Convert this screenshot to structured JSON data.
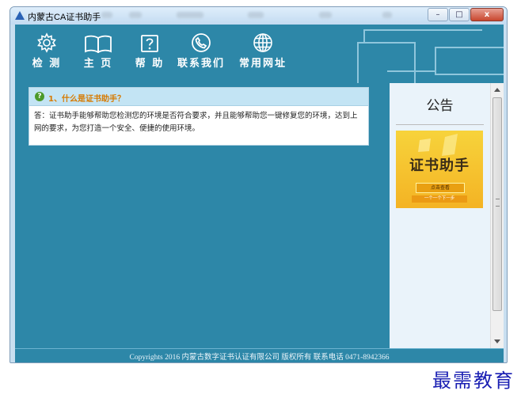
{
  "window": {
    "title": "内蒙古CA证书助手",
    "controls": {
      "minimize": "–",
      "maximize": "□",
      "close": "x"
    }
  },
  "toolbar": {
    "items": [
      {
        "label": "检 测",
        "icon": "gear-icon"
      },
      {
        "label": "主 页",
        "icon": "book-icon"
      },
      {
        "label": "帮 助",
        "icon": "help-icon"
      },
      {
        "label": "联系我们",
        "icon": "phone-icon"
      },
      {
        "label": "常用网址",
        "icon": "globe-icon"
      }
    ]
  },
  "faq": {
    "question": "1、什么是证书助手？",
    "answer": "答：证书助手能够帮助您检测您的环境是否符合要求，并且能够帮助您一键修复您的环境，达到上网的要求，为您打造一个安全、便捷的使用环境。"
  },
  "notice": {
    "title": "公告",
    "banner": {
      "title": "证书助手",
      "button": "点击查看",
      "subtitle": "一个一个下一步"
    }
  },
  "footer": {
    "copyright": "Copyrights 2016 内蒙古数字证书认证有限公司 版权所有 联系电话 0471-8942366"
  },
  "watermark": "最需教育",
  "colors": {
    "toolbar_bg": "#2d87a8",
    "question_color": "#d77a00"
  }
}
